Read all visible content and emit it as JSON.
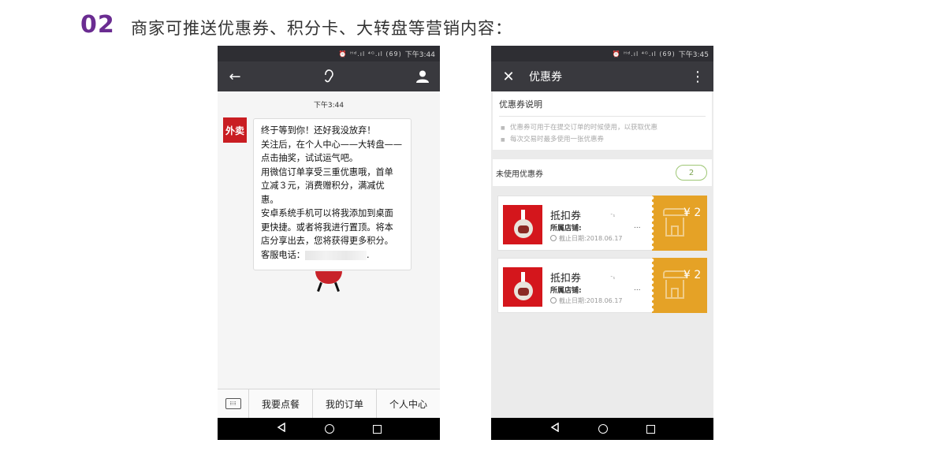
{
  "heading": {
    "number": "02",
    "text": "商家可推送优惠券、积分卡、大转盘等营销内容："
  },
  "phone1": {
    "status_time": "下午3:44",
    "status_icons": "⏰ ᴴᵈ.ıl ⁴ᴳ.ıl (69)",
    "chat_time": "下午3:44",
    "avatar_text": "外卖",
    "message_lines": [
      "终于等到你！还好我没放弃！",
      "关注后，在个人中心——大转盘——",
      "点击抽奖，试试运气吧。",
      "用微信订单享受三重优惠哦，首单",
      "立减３元，消费赠积分，满减优",
      "惠。",
      "安卓系统手机可以将我添加到桌面",
      "更快捷。或者将我进行置顶。将本",
      "店分享出去，您将获得更多积分。"
    ],
    "service_phone_label": "客服电话：",
    "service_phone_end": ".",
    "menu": [
      "我要点餐",
      "我的订单",
      "个人中心"
    ]
  },
  "phone2": {
    "status_time": "下午3:45",
    "status_icons": "⏰ ᴴᵈ.ıl ⁴ᴳ.ıl (69)",
    "title": "优惠券",
    "intro_title": "优惠券说明",
    "intro_items": [
      "优惠券可用于在提交订单的时候使用，以获取优惠",
      "每次交易时最多使用一张优惠券"
    ],
    "unused_label": "未使用优惠券",
    "unused_count": "2",
    "coupons": [
      {
        "name": "抵扣券",
        "store_label": "所属店铺:",
        "store_value": "...",
        "mark": "ˉ¹",
        "expire": "截止日期:2018.06.17",
        "price": "¥ 2"
      },
      {
        "name": "抵扣券",
        "store_label": "所属店铺:",
        "store_value": "...",
        "mark": "ˉ¹",
        "expire": "截止日期:2018.06.17",
        "price": "¥ 2"
      }
    ]
  },
  "colors": {
    "heading_number": "#6a2c91",
    "topbar": "#39393e",
    "coupon_stub": "#e5a226",
    "brand_red": "#d4161c"
  },
  "icons": [
    "back-arrow-icon",
    "ear-icon",
    "profile-icon",
    "close-icon",
    "more-vert-icon",
    "keyboard-icon",
    "nav-back-icon",
    "nav-home-icon",
    "nav-recents-icon",
    "clock-icon",
    "shop-icon"
  ]
}
